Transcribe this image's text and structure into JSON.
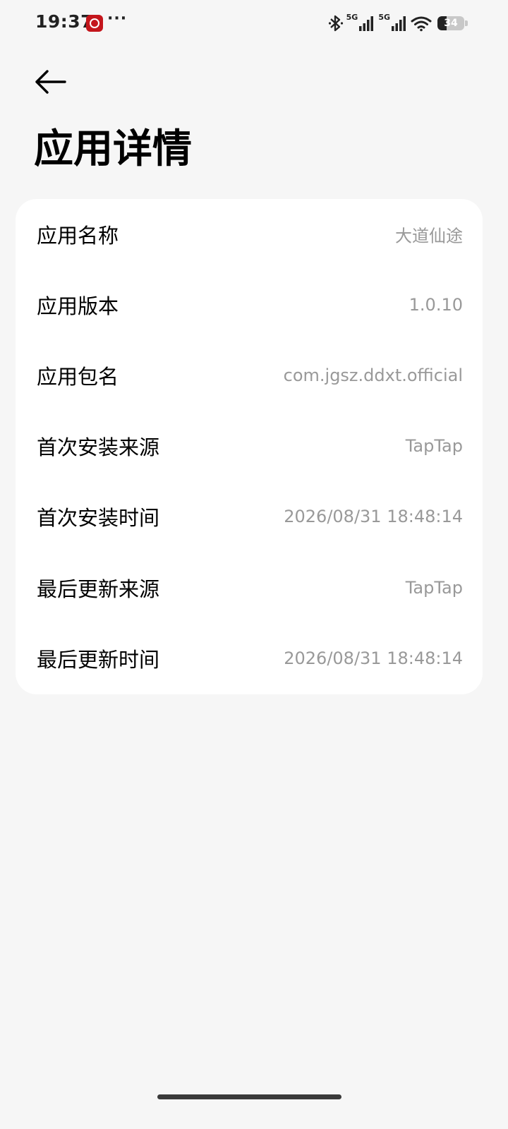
{
  "status_bar": {
    "time": "19:37",
    "more": "···",
    "signal_1_label": "5G",
    "signal_2_label": "5G",
    "battery_level": "34",
    "battery_fraction": 0.34
  },
  "header": {
    "title": "应用详情"
  },
  "details": [
    {
      "label": "应用名称",
      "value": "大道仙途"
    },
    {
      "label": "应用版本",
      "value": "1.0.10"
    },
    {
      "label": "应用包名",
      "value": "com.jgsz.ddxt.official"
    },
    {
      "label": "首次安装来源",
      "value": "TapTap"
    },
    {
      "label": "首次安装时间",
      "value": "2026/08/31 18:48:14"
    },
    {
      "label": "最后更新来源",
      "value": "TapTap"
    },
    {
      "label": "最后更新时间",
      "value": "2026/08/31 18:48:14"
    }
  ],
  "colors": {
    "background": "#f6f6f6",
    "card": "#ffffff",
    "value_text": "#999999",
    "notify_icon": "#c4161c"
  }
}
